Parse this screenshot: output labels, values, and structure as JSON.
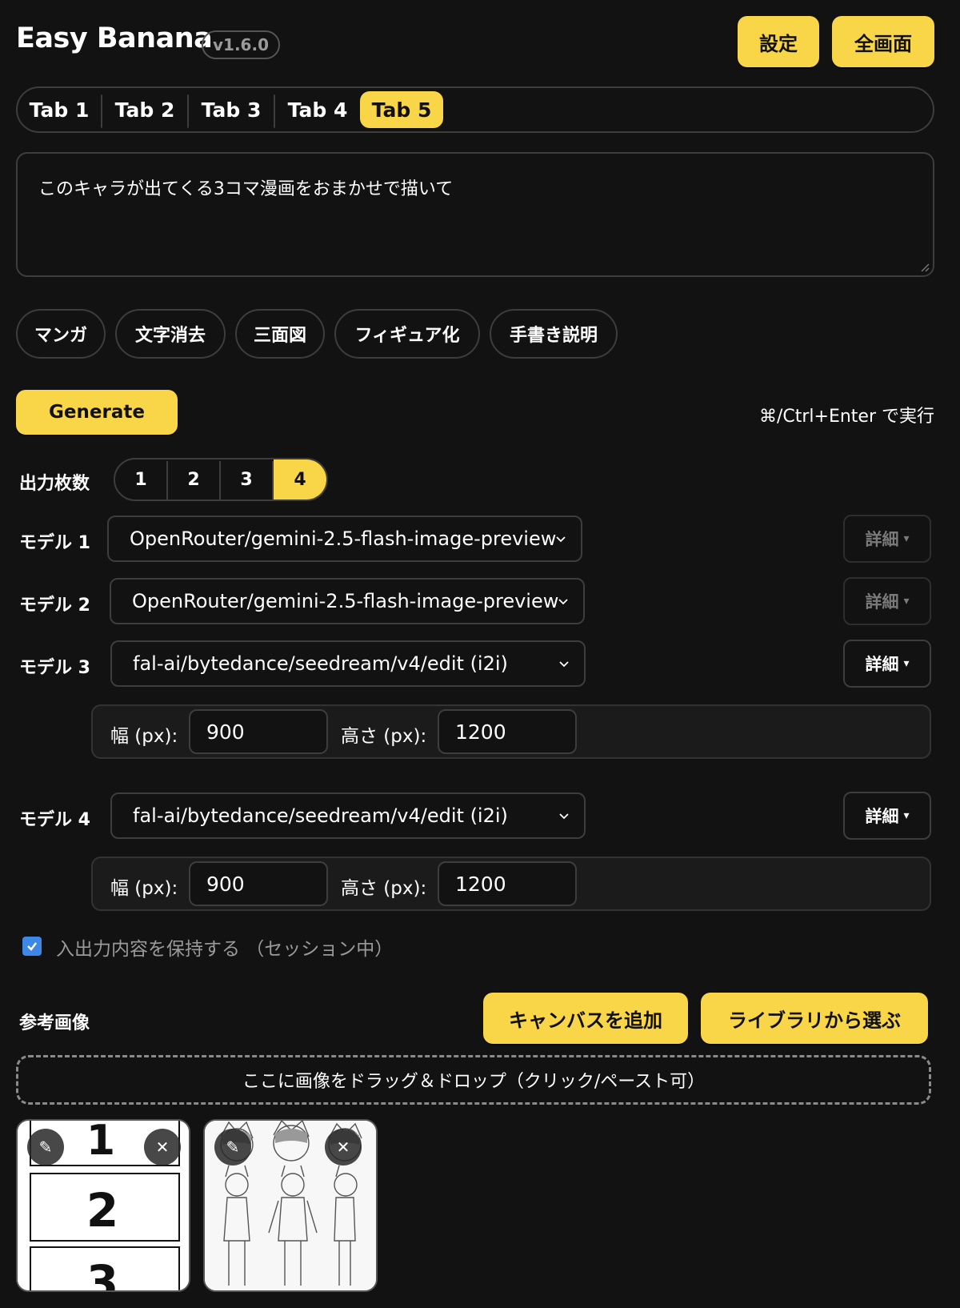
{
  "header": {
    "app_title": "Easy Banana",
    "version": "v1.6.0",
    "settings_label": "設定",
    "fullscreen_label": "全画面"
  },
  "tabs": [
    {
      "label": "Tab 1",
      "active": false
    },
    {
      "label": "Tab 2",
      "active": false
    },
    {
      "label": "Tab 3",
      "active": false
    },
    {
      "label": "Tab 4",
      "active": false
    },
    {
      "label": "Tab 5",
      "active": true
    }
  ],
  "prompt": {
    "value": "このキャラが出てくる3コマ漫画をおまかせで描いて"
  },
  "presets": [
    "マンガ",
    "文字消去",
    "三面図",
    "フィギュア化",
    "手書き説明"
  ],
  "generate": {
    "label": "Generate",
    "shortcut_hint": "⌘/Ctrl+Enter で実行"
  },
  "output_count": {
    "label": "出力枚数",
    "options": [
      "1",
      "2",
      "3",
      "4"
    ],
    "selected": "4"
  },
  "models": [
    {
      "label": "モデル 1",
      "value": "OpenRouter/gemini-2.5-flash-image-preview",
      "detail_label": "詳細",
      "detail_enabled": false
    },
    {
      "label": "モデル 2",
      "value": "OpenRouter/gemini-2.5-flash-image-preview",
      "detail_label": "詳細",
      "detail_enabled": false
    },
    {
      "label": "モデル 3",
      "value": "fal-ai/bytedance/seedream/v4/edit (i2i)",
      "detail_label": "詳細",
      "detail_enabled": true,
      "width_label": "幅 (px):",
      "width_value": "900",
      "height_label": "高さ (px):",
      "height_value": "1200"
    },
    {
      "label": "モデル 4",
      "value": "fal-ai/bytedance/seedream/v4/edit (i2i)",
      "detail_label": "詳細",
      "detail_enabled": true,
      "width_label": "幅 (px):",
      "width_value": "900",
      "height_label": "高さ (px):",
      "height_value": "1200"
    }
  ],
  "keep_io": {
    "label": "入出力内容を保持する （セッション中）",
    "checked": true
  },
  "reference": {
    "label": "参考画像",
    "add_canvas_label": "キャンバスを追加",
    "choose_library_label": "ライブラリから選ぶ",
    "dropzone_text": "ここに画像をドラッグ＆ドロップ（クリック/ペースト可）",
    "thumb1_panels": [
      "1",
      "2",
      "3"
    ]
  },
  "colors": {
    "accent": "#f9d548",
    "background": "#121212",
    "border": "#3d3d3d",
    "checkbox": "#3d87e6"
  },
  "icons": {
    "edit": "pencil-icon",
    "remove": "close-icon",
    "dropdown": "chevron-down-icon"
  }
}
